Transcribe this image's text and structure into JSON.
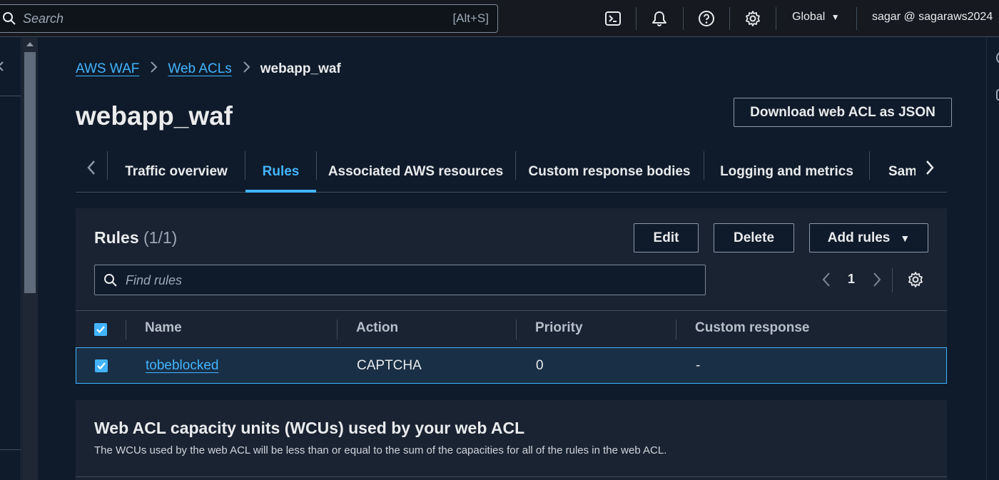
{
  "topnav": {
    "search_placeholder": "Search",
    "search_shortcut": "[Alt+S]",
    "region": "Global",
    "account": "sagar @ sagaraws2024"
  },
  "breadcrumb": {
    "items": [
      "AWS WAF",
      "Web ACLs"
    ],
    "current": "webapp_waf"
  },
  "page": {
    "title": "webapp_waf",
    "download_label": "Download web ACL as JSON"
  },
  "tabs": [
    {
      "label": "Traffic overview"
    },
    {
      "label": "Rules"
    },
    {
      "label": "Associated AWS resources"
    },
    {
      "label": "Custom response bodies"
    },
    {
      "label": "Logging and metrics"
    },
    {
      "label": "Sam"
    }
  ],
  "rules_panel": {
    "title": "Rules",
    "count": "(1/1)",
    "edit_label": "Edit",
    "delete_label": "Delete",
    "add_rules_label": "Add rules",
    "find_placeholder": "Find rules",
    "page_number": "1",
    "columns": [
      "Name",
      "Action",
      "Priority",
      "Custom response"
    ],
    "rows": [
      {
        "name": "tobeblocked",
        "action": "CAPTCHA",
        "priority": "0",
        "custom_response": "-"
      }
    ]
  },
  "wcu": {
    "title": "Web ACL capacity units (WCUs) used by your web ACL",
    "description": "The WCUs used by the web ACL will be less than or equal to the sum of the capacities for all of the rules in the web ACL."
  },
  "colors": {
    "accent": "#42b4ff",
    "background": "#0f1b2a",
    "panel": "#1a2332",
    "selected_row": "#192f45"
  }
}
